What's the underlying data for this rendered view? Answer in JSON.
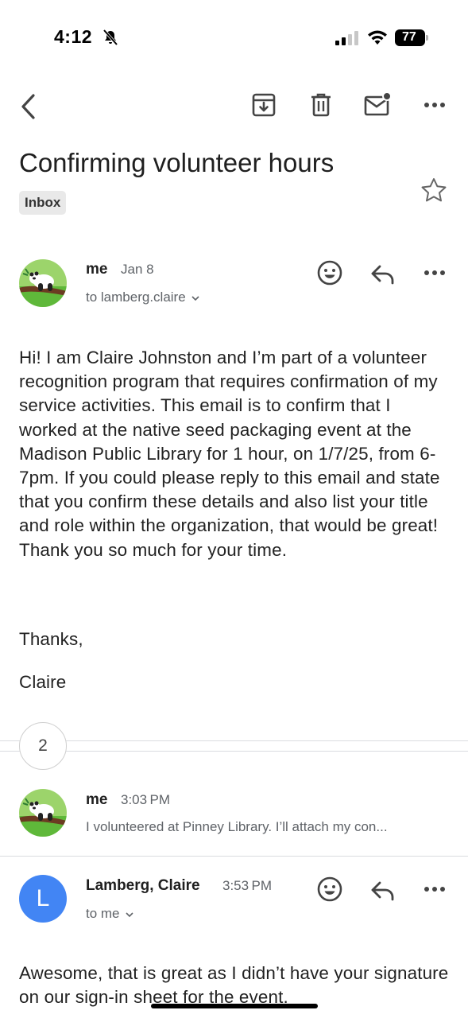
{
  "status_bar": {
    "time": "4:12",
    "battery": "77"
  },
  "toolbar": {
    "icons": [
      "back-icon",
      "archive-icon",
      "trash-icon",
      "mark-unread-icon",
      "more-icon"
    ]
  },
  "thread": {
    "subject": "Confirming volunteer hours",
    "label": "Inbox",
    "message_count_collapsed": "2"
  },
  "messages": [
    {
      "sender": "me",
      "date": "Jan 8",
      "recipient": "to lamberg.claire",
      "body": "Hi! I am Claire Johnston and I’m part of a volunteer recognition program that requires confirmation of my service activities. This email is to confirm that I worked at the native seed packaging event at the Madison Public Library for 1 hour, on 1/7/25, from 6-7pm. If you could please reply to  this email and state that you confirm these details and also list your title and role within the organization, that would be great! Thank you so much for your time.",
      "closing": "Thanks,",
      "signature": "Claire"
    },
    {
      "sender": "me",
      "date": "3:03 PM",
      "snippet": "I volunteered at Pinney Library. I’ll attach my con..."
    },
    {
      "sender": "Lamberg, Claire",
      "avatar_letter": "L",
      "date": "3:53 PM",
      "recipient": "to me",
      "body": "Awesome, that is great as I didn’t have your signature on our sign-in sheet for the event."
    }
  ],
  "colors": {
    "avatar_blue": "#4285f4",
    "secondary_text": "#5f6368",
    "chip_bg": "#e9e9e9"
  }
}
